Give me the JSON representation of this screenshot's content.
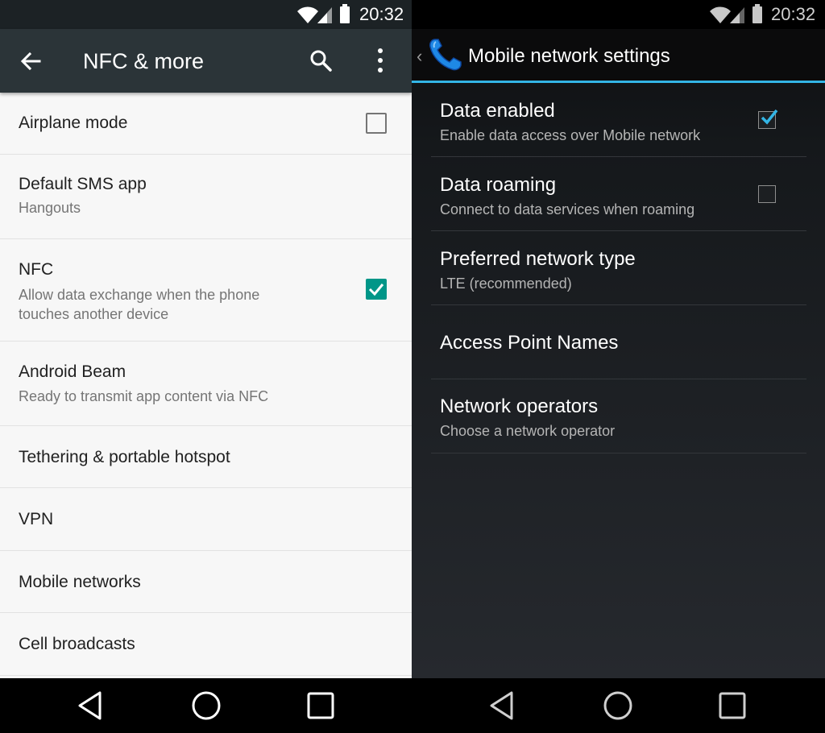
{
  "status_bar": {
    "time": "20:32",
    "icons": [
      "wifi-icon",
      "signal-icon",
      "battery-icon"
    ]
  },
  "left_panel": {
    "title": "NFC & more",
    "icons": [
      "back-arrow-icon",
      "search-icon",
      "more-vert-icon"
    ],
    "items": [
      {
        "title": "Airplane mode",
        "checkbox": false
      },
      {
        "title": "Default SMS app",
        "subtitle": "Hangouts"
      },
      {
        "title": "NFC",
        "subtitle_lines": [
          "Allow data exchange when the phone",
          "touches another device"
        ],
        "checkbox": true
      },
      {
        "title": "Android Beam",
        "subtitle": "Ready to transmit app content via NFC"
      },
      {
        "title": "Tethering & portable hotspot"
      },
      {
        "title": "VPN"
      },
      {
        "title": "Mobile networks"
      },
      {
        "title": "Cell broadcasts"
      }
    ],
    "accent": "#009688"
  },
  "right_panel": {
    "title": "Mobile network settings",
    "icons": [
      "up-chevron-icon",
      "phone-icon"
    ],
    "items": [
      {
        "title": "Data enabled",
        "subtitle": "Enable data access over Mobile network",
        "checkbox": true
      },
      {
        "title": "Data roaming",
        "subtitle": "Connect to data services when roaming",
        "checkbox": false
      },
      {
        "title": "Preferred network type",
        "subtitle": "LTE (recommended)"
      },
      {
        "title": "Access Point Names"
      },
      {
        "title": "Network operators",
        "subtitle": "Choose a network operator"
      }
    ],
    "accent": "#33b5e5"
  },
  "nav_bar": {
    "icons": [
      "back-triangle-icon",
      "home-circle-icon",
      "recents-square-icon"
    ]
  }
}
